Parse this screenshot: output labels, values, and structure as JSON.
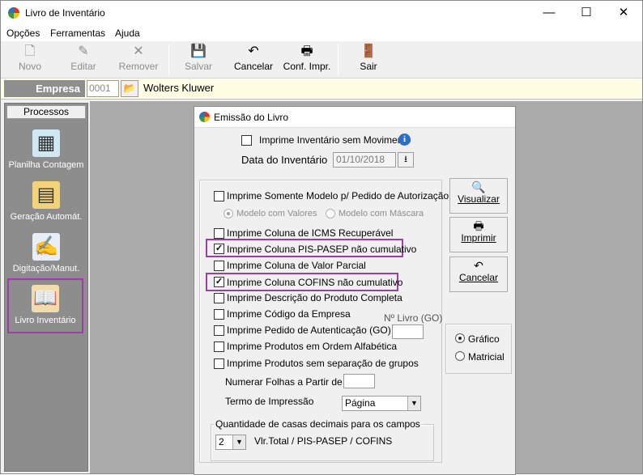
{
  "window": {
    "title": "Livro de Inventário",
    "minimize": "—",
    "maximize": "☐",
    "close": "✕"
  },
  "menu": {
    "items": [
      "Opções",
      "Ferramentas",
      "Ajuda"
    ]
  },
  "toolbar": {
    "novo": "Novo",
    "editar": "Editar",
    "remover": "Remover",
    "salvar": "Salvar",
    "cancelar": "Cancelar",
    "conf_impr": "Conf. Impr.",
    "sair": "Sair"
  },
  "empresa": {
    "label": "Empresa",
    "code": "0001",
    "name": "Wolters Kluwer"
  },
  "sidebar": {
    "header": "Processos",
    "items": [
      {
        "label": "Planilha Contagem",
        "icon": "calculator-icon"
      },
      {
        "label": "Geração Automát.",
        "icon": "automatic-generation-icon"
      },
      {
        "label": "Digitação/Manut.",
        "icon": "typing-icon"
      },
      {
        "label": "Livro Inventário",
        "icon": "book-icon"
      }
    ]
  },
  "dialog": {
    "title": "Emissão do Livro",
    "sem_movimento": "Imprime Inventário sem Movimento",
    "data_label": "Data do Inventário",
    "data_value": "01/10/2018",
    "options": {
      "somente_modelo": "Imprime Somente Modelo p/ Pedido de Autorização",
      "modelo_valores": "Modelo com Valores",
      "modelo_mascara": "Modelo com Máscara",
      "icms": "Imprime Coluna de ICMS Recuperável",
      "pis": "Imprime Coluna PIS-PASEP não cumulativo",
      "valor_parcial": "Imprime Coluna de Valor Parcial",
      "cofins": "Imprime Coluna COFINS não cumulativo",
      "descricao": "Imprime Descrição do Produto Completa",
      "codigo_empresa": "Imprime Código da Empresa",
      "pedido_aut": "Imprime Pedido de Autenticação (GO)",
      "ordem_alfa": "Imprime Produtos em Ordem Alfabética",
      "sem_separacao": "Imprime Produtos sem separação de grupos"
    },
    "nlivro_label": "Nº Livro (GO)",
    "nlivro_value": "",
    "numerar_label": "Numerar Folhas a Partir de :",
    "numerar_value": "",
    "termo_label": "Termo de Impressão",
    "termo_value": "Página",
    "decimais_title": "Quantidade de casas decimais para os campos",
    "decimais_value": "2",
    "decimais_desc": "Vlr.Total / PIS-PASEP / COFINS",
    "buttons": {
      "visualizar": "Visualizar",
      "imprimir": "Imprimir",
      "cancelar": "Cancelar"
    },
    "output": {
      "grafico": "Gráfico",
      "matricial": "Matricial"
    },
    "checked": {
      "pis": true,
      "cofins": true
    }
  }
}
